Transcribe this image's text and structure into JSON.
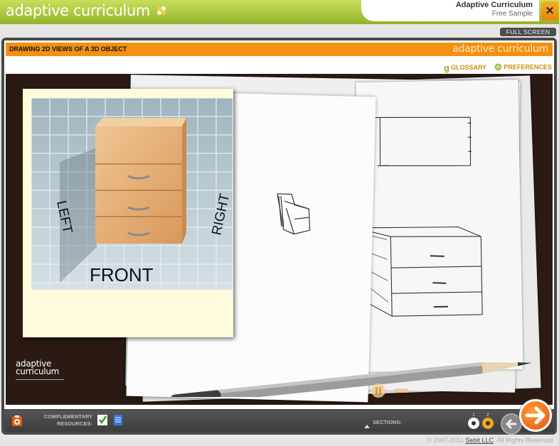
{
  "header": {
    "logo_text": "adaptive curriculum",
    "app_name": "Adaptive Curriculum",
    "app_subtitle": "Free Sample",
    "close_label": "✕"
  },
  "fullscreen_label": "FULL SCREEN",
  "lesson": {
    "title": "DRAWING 2D VIEWS OF A 3D OBJECT",
    "bar_logo": "adaptive curriculum"
  },
  "links": {
    "glossary": "GLOSSARY",
    "preferences": "PREFERENCES"
  },
  "photo_labels": {
    "front": "FRONT",
    "left": "LEFT",
    "right": "RIGHT"
  },
  "stage_logo": {
    "line1": "adaptive",
    "line2": "curriculum"
  },
  "toolbar": {
    "complementary_line1": "COMPLEMENTARY",
    "complementary_line2": "RESOURCES:",
    "sections_label": "SECTIONS:",
    "sections": [
      {
        "number": "1",
        "color": "#ffffff"
      },
      {
        "number": "2",
        "color": "#f5a623"
      }
    ]
  },
  "footer": {
    "copyright_prefix": "© 2007-2011",
    "company": "Sebit LLC",
    "rights": ". All Rights Reserved."
  },
  "colors": {
    "header_green": "#a6c13a",
    "accent_orange": "#f29111",
    "stage_background": "#2a1a13",
    "photo_card": "#fffbdc"
  }
}
